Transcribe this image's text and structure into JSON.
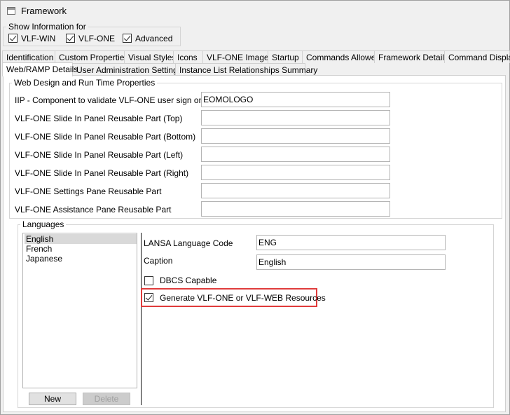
{
  "window": {
    "title": "Framework"
  },
  "show_info": {
    "label": "Show Information for",
    "options": [
      {
        "label": "VLF-WIN",
        "checked": true
      },
      {
        "label": "VLF-ONE",
        "checked": true
      },
      {
        "label": "Advanced",
        "checked": true
      }
    ]
  },
  "tabs": {
    "row1": [
      "Identification",
      "Custom Properties",
      "Visual Styles",
      "Icons",
      "VLF-ONE Images",
      "Startup",
      "Commands Allowed",
      "Framework Details",
      "Command Display"
    ],
    "row2": [
      "Web/RAMP Details",
      "User Administration Settings",
      "Instance List Relationships Summary"
    ],
    "active": "Web/RAMP Details"
  },
  "web_design": {
    "label": "Web Design and Run Time Properties",
    "fields": [
      {
        "label": "IIP - Component to validate VLF-ONE user sign on",
        "value": "EOMOLOGO"
      },
      {
        "label": "VLF-ONE Slide In Panel Reusable Part (Top)",
        "value": ""
      },
      {
        "label": "VLF-ONE Slide In Panel Reusable Part (Bottom)",
        "value": ""
      },
      {
        "label": "VLF-ONE Slide In Panel Reusable Part (Left)",
        "value": ""
      },
      {
        "label": "VLF-ONE Slide In Panel Reusable Part (Right)",
        "value": ""
      },
      {
        "label": "VLF-ONE Settings Pane Reusable Part",
        "value": ""
      },
      {
        "label": "VLF-ONE Assistance Pane Reusable Part",
        "value": ""
      }
    ]
  },
  "languages": {
    "label": "Languages",
    "items": [
      "English",
      "French",
      "Japanese"
    ],
    "selected": "English",
    "new_label": "New",
    "delete_label": "Delete",
    "code_label": "LANSA Language Code",
    "code_value": "ENG",
    "caption_label": "Caption",
    "caption_value": "English",
    "dbcs_label": "DBCS Capable",
    "dbcs_checked": false,
    "generate_label": "Generate VLF-ONE or VLF-WEB Resources",
    "generate_checked": true,
    "highlight_color": "#e03b3b"
  }
}
